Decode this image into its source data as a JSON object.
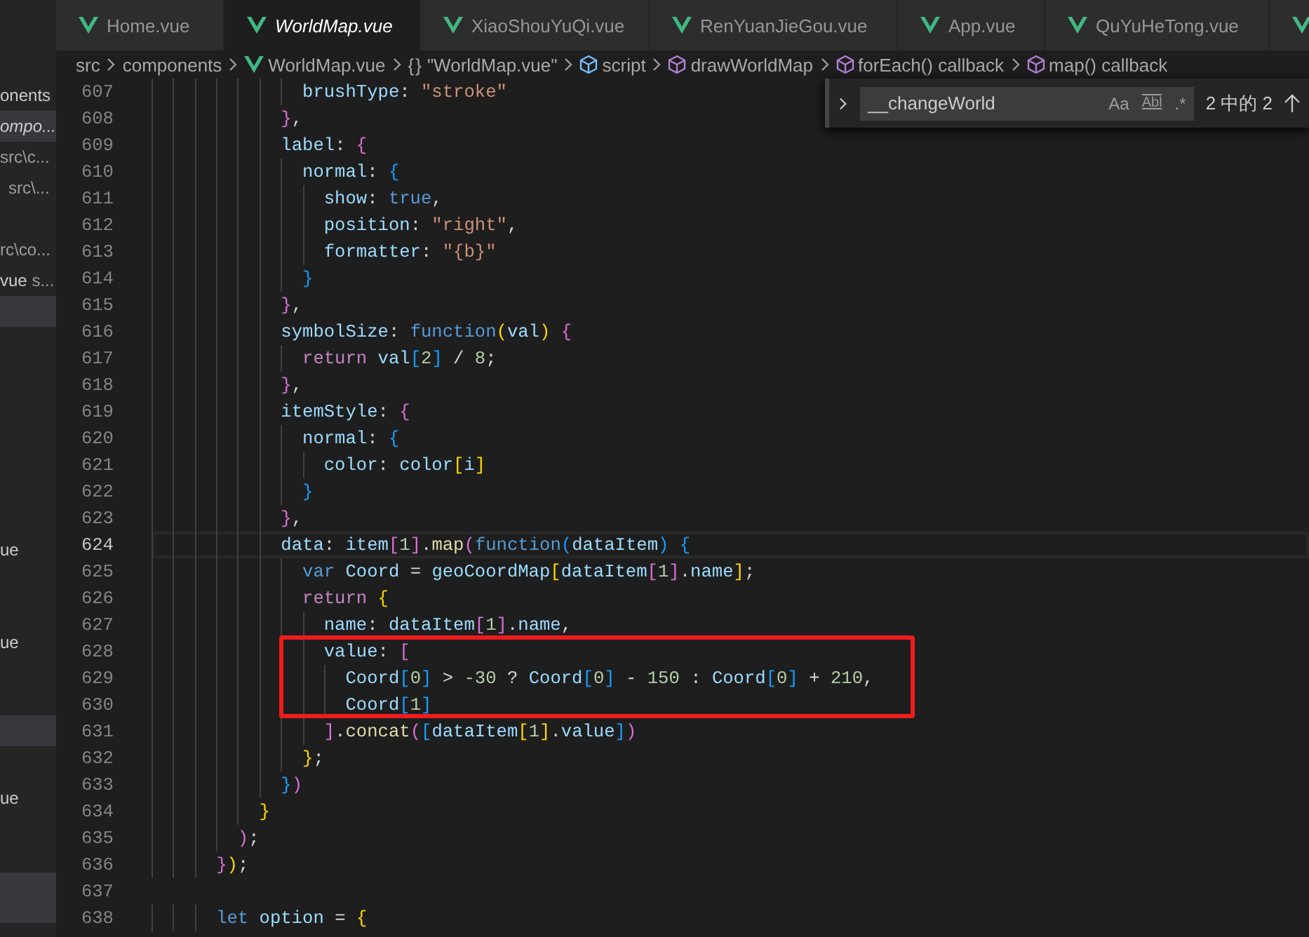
{
  "sidebar": {
    "items": [
      {
        "text": "onents",
        "selected": false
      },
      {
        "text": "ompo...",
        "selected": true
      },
      {
        "text": "src\\c...",
        "selected": false
      },
      {
        "text": "src\\...",
        "selected": false
      },
      {
        "text": "rc\\co...",
        "selected": false
      },
      {
        "text": "vue",
        "detail": "s...",
        "selected": false
      },
      {
        "selected": true
      }
    ],
    "lower_items": [
      {
        "text": "ue",
        "selected": false
      },
      {
        "text": "ue",
        "selected": false
      },
      {
        "selected": true
      },
      {
        "text": "ue",
        "selected": false
      },
      {
        "selected": true
      }
    ]
  },
  "tabs": [
    {
      "label": "Home.vue",
      "selected": false
    },
    {
      "label": "WorldMap.vue",
      "selected": true
    },
    {
      "label": "XiaoShouYuQi.vue",
      "selected": false
    },
    {
      "label": "RenYuanJieGou.vue",
      "selected": false
    },
    {
      "label": "App.vue",
      "selected": false
    },
    {
      "label": "QuYuHeTong.vue",
      "selected": false
    },
    {
      "selected": false
    }
  ],
  "breadcrumb": [
    {
      "text": "src",
      "kind": "plain"
    },
    {
      "text": "components",
      "kind": "plain"
    },
    {
      "text": "WorldMap.vue",
      "kind": "vue"
    },
    {
      "text": "\"WorldMap.vue\"",
      "kind": "module",
      "glyph": "{}"
    },
    {
      "text": "script",
      "kind": "element"
    },
    {
      "text": "drawWorldMap",
      "kind": "method"
    },
    {
      "text": "forEach() callback",
      "kind": "method"
    },
    {
      "text": "map() callback",
      "kind": "method"
    }
  ],
  "find": {
    "value": "__changeWorld",
    "options": [
      "Aa",
      "Abl",
      ".*"
    ],
    "count": "2 中的 2"
  },
  "code": [
    {
      "number": "607",
      "current": false,
      "tokens": [
        {
          "kind": "prop",
          "text": "              brushType"
        },
        {
          "kind": "punct",
          "text": ": "
        },
        {
          "kind": "str",
          "text": "\"stroke\""
        }
      ]
    },
    {
      "number": "608",
      "current": false,
      "tokens": [
        {
          "kind": "b2",
          "text": "            }"
        },
        {
          "kind": "punct",
          "text": ","
        }
      ]
    },
    {
      "number": "609",
      "current": false,
      "tokens": [
        {
          "kind": "prop",
          "text": "            label"
        },
        {
          "kind": "punct",
          "text": ": "
        },
        {
          "kind": "b2",
          "text": "{"
        }
      ]
    },
    {
      "number": "610",
      "current": false,
      "tokens": [
        {
          "kind": "prop",
          "text": "              normal"
        },
        {
          "kind": "punct",
          "text": ": "
        },
        {
          "kind": "b3",
          "text": "{"
        }
      ]
    },
    {
      "number": "611",
      "current": false,
      "tokens": [
        {
          "kind": "prop",
          "text": "                show"
        },
        {
          "kind": "punct",
          "text": ": "
        },
        {
          "kind": "kw",
          "text": "true"
        },
        {
          "kind": "punct",
          "text": ","
        }
      ]
    },
    {
      "number": "612",
      "current": false,
      "tokens": [
        {
          "kind": "prop",
          "text": "                position"
        },
        {
          "kind": "punct",
          "text": ": "
        },
        {
          "kind": "str",
          "text": "\"right\""
        },
        {
          "kind": "punct",
          "text": ","
        }
      ]
    },
    {
      "number": "613",
      "current": false,
      "tokens": [
        {
          "kind": "prop",
          "text": "                formatter"
        },
        {
          "kind": "punct",
          "text": ": "
        },
        {
          "kind": "str",
          "text": "\"{b}\""
        }
      ]
    },
    {
      "number": "614",
      "current": false,
      "tokens": [
        {
          "kind": "b3",
          "text": "              }"
        }
      ]
    },
    {
      "number": "615",
      "current": false,
      "tokens": [
        {
          "kind": "b2",
          "text": "            }"
        },
        {
          "kind": "punct",
          "text": ","
        }
      ]
    },
    {
      "number": "616",
      "current": false,
      "tokens": [
        {
          "kind": "prop",
          "text": "            symbolSize"
        },
        {
          "kind": "punct",
          "text": ": "
        },
        {
          "kind": "kw",
          "text": "function"
        },
        {
          "kind": "b1",
          "text": "("
        },
        {
          "kind": "var",
          "text": "val"
        },
        {
          "kind": "b1",
          "text": ")"
        },
        {
          "kind": "b2",
          "text": " {"
        }
      ]
    },
    {
      "number": "617",
      "current": false,
      "tokens": [
        {
          "kind": "ctrl",
          "text": "              return"
        },
        {
          "kind": "var",
          "text": " val"
        },
        {
          "kind": "b3",
          "text": "["
        },
        {
          "kind": "num",
          "text": "2"
        },
        {
          "kind": "b3",
          "text": "]"
        },
        {
          "kind": "punct",
          "text": " / "
        },
        {
          "kind": "num",
          "text": "8"
        },
        {
          "kind": "punct",
          "text": ";"
        }
      ]
    },
    {
      "number": "618",
      "current": false,
      "tokens": [
        {
          "kind": "b2",
          "text": "            }"
        },
        {
          "kind": "punct",
          "text": ","
        }
      ]
    },
    {
      "number": "619",
      "current": false,
      "tokens": [
        {
          "kind": "prop",
          "text": "            itemStyle"
        },
        {
          "kind": "punct",
          "text": ": "
        },
        {
          "kind": "b2",
          "text": "{"
        }
      ]
    },
    {
      "number": "620",
      "current": false,
      "tokens": [
        {
          "kind": "prop",
          "text": "              normal"
        },
        {
          "kind": "punct",
          "text": ": "
        },
        {
          "kind": "b3",
          "text": "{"
        }
      ]
    },
    {
      "number": "621",
      "current": false,
      "tokens": [
        {
          "kind": "prop",
          "text": "                color"
        },
        {
          "kind": "punct",
          "text": ": "
        },
        {
          "kind": "var",
          "text": "color"
        },
        {
          "kind": "b1",
          "text": "["
        },
        {
          "kind": "var",
          "text": "i"
        },
        {
          "kind": "b1",
          "text": "]"
        }
      ]
    },
    {
      "number": "622",
      "current": false,
      "tokens": [
        {
          "kind": "b3",
          "text": "              }"
        }
      ]
    },
    {
      "number": "623",
      "current": false,
      "tokens": [
        {
          "kind": "b2",
          "text": "            }"
        },
        {
          "kind": "punct",
          "text": ","
        }
      ]
    },
    {
      "number": "624",
      "current": true,
      "tokens": [
        {
          "kind": "prop",
          "text": "            data"
        },
        {
          "kind": "punct",
          "text": ": "
        },
        {
          "kind": "var",
          "text": "item"
        },
        {
          "kind": "b2",
          "text": "["
        },
        {
          "kind": "num",
          "text": "1"
        },
        {
          "kind": "b2",
          "text": "]"
        },
        {
          "kind": "punct",
          "text": "."
        },
        {
          "kind": "fn",
          "text": "map"
        },
        {
          "kind": "b2",
          "text": "("
        },
        {
          "kind": "kw",
          "text": "function"
        },
        {
          "kind": "b3",
          "text": "("
        },
        {
          "kind": "var",
          "text": "dataItem"
        },
        {
          "kind": "b3",
          "text": ")"
        },
        {
          "kind": "b3",
          "text": " {"
        }
      ]
    },
    {
      "number": "625",
      "current": false,
      "tokens": [
        {
          "kind": "kw",
          "text": "              var"
        },
        {
          "kind": "var",
          "text": " Coord"
        },
        {
          "kind": "punct",
          "text": " = "
        },
        {
          "kind": "var",
          "text": "geoCoordMap"
        },
        {
          "kind": "b1",
          "text": "["
        },
        {
          "kind": "var",
          "text": "dataItem"
        },
        {
          "kind": "b2",
          "text": "["
        },
        {
          "kind": "num",
          "text": "1"
        },
        {
          "kind": "b2",
          "text": "]"
        },
        {
          "kind": "punct",
          "text": "."
        },
        {
          "kind": "prop",
          "text": "name"
        },
        {
          "kind": "b1",
          "text": "]"
        },
        {
          "kind": "punct",
          "text": ";"
        }
      ]
    },
    {
      "number": "626",
      "current": false,
      "tokens": [
        {
          "kind": "ctrl",
          "text": "              return"
        },
        {
          "kind": "b1",
          "text": " {"
        }
      ]
    },
    {
      "number": "627",
      "current": false,
      "tokens": [
        {
          "kind": "prop",
          "text": "                name"
        },
        {
          "kind": "punct",
          "text": ": "
        },
        {
          "kind": "var",
          "text": "dataItem"
        },
        {
          "kind": "b2",
          "text": "["
        },
        {
          "kind": "num",
          "text": "1"
        },
        {
          "kind": "b2",
          "text": "]"
        },
        {
          "kind": "punct",
          "text": "."
        },
        {
          "kind": "prop",
          "text": "name"
        },
        {
          "kind": "punct",
          "text": ","
        }
      ]
    },
    {
      "number": "628",
      "current": false,
      "tokens": [
        {
          "kind": "prop",
          "text": "                value"
        },
        {
          "kind": "punct",
          "text": ": "
        },
        {
          "kind": "b2",
          "text": "["
        }
      ]
    },
    {
      "number": "629",
      "current": false,
      "tokens": [
        {
          "kind": "var",
          "text": "                  Coord"
        },
        {
          "kind": "b3",
          "text": "["
        },
        {
          "kind": "num",
          "text": "0"
        },
        {
          "kind": "b3",
          "text": "]"
        },
        {
          "kind": "punct",
          "text": " > "
        },
        {
          "kind": "num",
          "text": "-30"
        },
        {
          "kind": "punct",
          "text": " ? "
        },
        {
          "kind": "var",
          "text": "Coord"
        },
        {
          "kind": "b3",
          "text": "["
        },
        {
          "kind": "num",
          "text": "0"
        },
        {
          "kind": "b3",
          "text": "]"
        },
        {
          "kind": "punct",
          "text": " - "
        },
        {
          "kind": "num",
          "text": "150"
        },
        {
          "kind": "punct",
          "text": " : "
        },
        {
          "kind": "var",
          "text": "Coord"
        },
        {
          "kind": "b3",
          "text": "["
        },
        {
          "kind": "num",
          "text": "0"
        },
        {
          "kind": "b3",
          "text": "]"
        },
        {
          "kind": "punct",
          "text": " + "
        },
        {
          "kind": "num",
          "text": "210"
        },
        {
          "kind": "punct",
          "text": ","
        }
      ]
    },
    {
      "number": "630",
      "current": false,
      "tokens": [
        {
          "kind": "var",
          "text": "                  Coord"
        },
        {
          "kind": "b3",
          "text": "["
        },
        {
          "kind": "num",
          "text": "1"
        },
        {
          "kind": "b3",
          "text": "]"
        }
      ]
    },
    {
      "number": "631",
      "current": false,
      "tokens": [
        {
          "kind": "b2",
          "text": "                ]"
        },
        {
          "kind": "punct",
          "text": "."
        },
        {
          "kind": "fn",
          "text": "concat"
        },
        {
          "kind": "b2",
          "text": "("
        },
        {
          "kind": "b3",
          "text": "["
        },
        {
          "kind": "var",
          "text": "dataItem"
        },
        {
          "kind": "b1",
          "text": "["
        },
        {
          "kind": "num",
          "text": "1"
        },
        {
          "kind": "b1",
          "text": "]"
        },
        {
          "kind": "punct",
          "text": "."
        },
        {
          "kind": "prop",
          "text": "value"
        },
        {
          "kind": "b3",
          "text": "]"
        },
        {
          "kind": "b2",
          "text": ")"
        }
      ]
    },
    {
      "number": "632",
      "current": false,
      "tokens": [
        {
          "kind": "b1",
          "text": "              }"
        },
        {
          "kind": "punct",
          "text": ";"
        }
      ]
    },
    {
      "number": "633",
      "current": false,
      "tokens": [
        {
          "kind": "b3",
          "text": "            }"
        },
        {
          "kind": "b2",
          "text": ")"
        }
      ]
    },
    {
      "number": "634",
      "current": false,
      "tokens": [
        {
          "kind": "b1",
          "text": "          }"
        }
      ]
    },
    {
      "number": "635",
      "current": false,
      "tokens": [
        {
          "kind": "b2",
          "text": "        )"
        },
        {
          "kind": "punct",
          "text": ";"
        }
      ]
    },
    {
      "number": "636",
      "current": false,
      "tokens": [
        {
          "kind": "b2",
          "text": "      }"
        },
        {
          "kind": "b1",
          "text": ")"
        },
        {
          "kind": "punct",
          "text": ";"
        }
      ]
    },
    {
      "number": "637",
      "current": false
    },
    {
      "number": "638",
      "current": false,
      "tokens": [
        {
          "kind": "kw",
          "text": "      let"
        },
        {
          "kind": "var",
          "text": " option"
        },
        {
          "kind": "punct",
          "text": " = "
        },
        {
          "kind": "b1",
          "text": "{"
        }
      ]
    }
  ]
}
